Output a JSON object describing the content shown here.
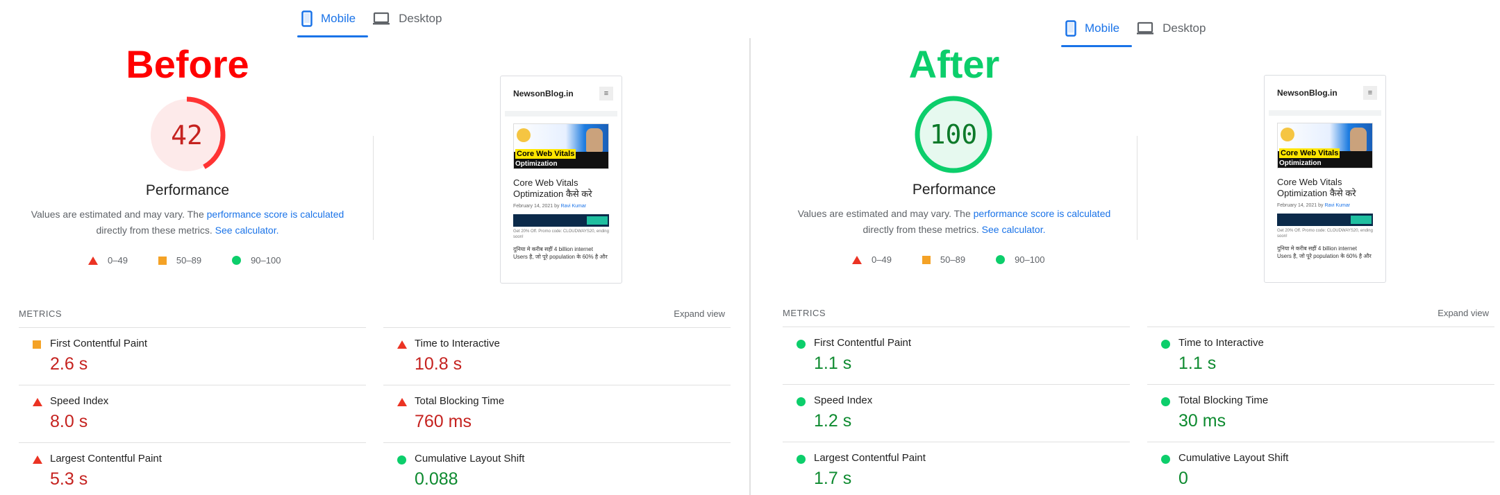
{
  "before": {
    "tabs": [
      {
        "label": "Mobile"
      },
      {
        "label": "Desktop"
      }
    ],
    "heading": "Before",
    "heading_color": "#ff0000",
    "score": "42",
    "score_fraction": 0.42,
    "score_color": "#ff3333",
    "performance_label": "Performance",
    "note": {
      "prefix": "Values are estimated and may vary. The ",
      "link1": "performance score is calculated",
      "middle": "directly from these metrics. ",
      "link2": "See calculator."
    },
    "legend": {
      "red": "0–49",
      "orange": "50–89",
      "green": "90–100"
    },
    "metrics_heading": "METRICS",
    "expand_label": "Expand view",
    "metrics": [
      {
        "name": "First Contentful Paint",
        "value": "2.6 s",
        "status": "orange"
      },
      {
        "name": "Time to Interactive",
        "value": "10.8 s",
        "status": "red"
      },
      {
        "name": "Speed Index",
        "value": "8.0 s",
        "status": "red"
      },
      {
        "name": "Total Blocking Time",
        "value": "760 ms",
        "status": "red"
      },
      {
        "name": "Largest Contentful Paint",
        "value": "5.3 s",
        "status": "red"
      },
      {
        "name": "Cumulative Layout Shift",
        "value": "0.088",
        "status": "green"
      }
    ]
  },
  "after": {
    "tabs": [
      {
        "label": "Mobile"
      },
      {
        "label": "Desktop"
      }
    ],
    "heading": "After",
    "heading_color": "#0cce6b",
    "score": "100",
    "score_fraction": 1.0,
    "score_color": "#0cce6b",
    "performance_label": "Performance",
    "note": {
      "prefix": "Values are estimated and may vary. The ",
      "link1": "performance score is calculated",
      "middle": "directly from these metrics. ",
      "link2": "See calculator."
    },
    "legend": {
      "red": "0–49",
      "orange": "50–89",
      "green": "90–100"
    },
    "metrics_heading": "METRICS",
    "expand_label": "Expand view",
    "metrics": [
      {
        "name": "First Contentful Paint",
        "value": "1.1 s",
        "status": "green"
      },
      {
        "name": "Time to Interactive",
        "value": "1.1 s",
        "status": "green"
      },
      {
        "name": "Speed Index",
        "value": "1.2 s",
        "status": "green"
      },
      {
        "name": "Total Blocking Time",
        "value": "30 ms",
        "status": "green"
      },
      {
        "name": "Largest Contentful Paint",
        "value": "1.7 s",
        "status": "green"
      },
      {
        "name": "Cumulative Layout Shift",
        "value": "0",
        "status": "green"
      }
    ]
  },
  "preview": {
    "site_name": "NewsonBlog.in",
    "menu_glyph": "≡",
    "hero_line1": "Core Web Vitals",
    "hero_line2": "Optimization",
    "title": "Core Web Vitals Optimization कैसे करे",
    "date": "February 14, 2021 by ",
    "author": "Ravi Kumar",
    "ad_note": "Get 20% Off. Promo code: CLOUDWAYS20, ending soon!",
    "body": "दुनिया मे करीब सहीं 4 billion internet Users है, जो पूरे population के 60% है और"
  }
}
